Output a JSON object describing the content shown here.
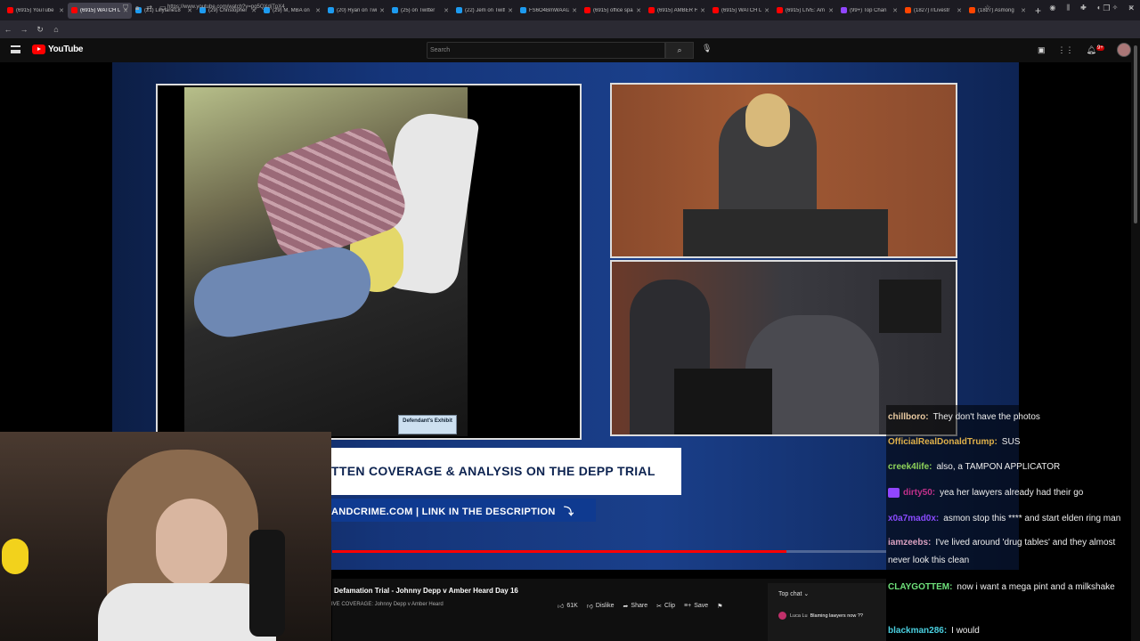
{
  "browser": {
    "tabs": [
      {
        "title": "(6915) YouTube",
        "color": "#f00"
      },
      {
        "title": "(6915) WATCH LIVE",
        "color": "#f00",
        "active": true
      },
      {
        "title": "(21) Lillylane18",
        "color": "#1d9bf0"
      },
      {
        "title": "(29) Christopher",
        "color": "#1d9bf0"
      },
      {
        "title": "(29) M, MBA on",
        "color": "#1d9bf0"
      },
      {
        "title": "(20) Ryan on Twitt",
        "color": "#1d9bf0"
      },
      {
        "title": "(25) on Twitter",
        "color": "#1d9bf0"
      },
      {
        "title": "(22) Jem on Twitt",
        "color": "#1d9bf0"
      },
      {
        "title": "FS6O4BmWAAU",
        "color": "#1d9bf0"
      },
      {
        "title": "(6915) office spa",
        "color": "#f00"
      },
      {
        "title": "(6915) AMBER H",
        "color": "#f00"
      },
      {
        "title": "(6915) WATCH L",
        "color": "#f00"
      },
      {
        "title": "(6915) LIVE: Am",
        "color": "#f00"
      },
      {
        "title": "(99+) Top Chan",
        "color": "#9146ff"
      },
      {
        "title": "(1827) r/Livestr",
        "color": "#ff4500"
      },
      {
        "title": "(1827) Asmong",
        "color": "#ff4500"
      }
    ],
    "url": "https://www.youtube.com/watch?v=pg5QXdjTpX4",
    "window_controls": [
      "–",
      "❐",
      "✕"
    ]
  },
  "youtube": {
    "logo_text": "YouTube",
    "search_placeholder": "Search",
    "notif_badge": "9+"
  },
  "video": {
    "banner_text": "TTEN COVERAGE & ANALYSIS ON THE DEPP TRIAL",
    "banner_link": "ANDCRIME.COM | LINK IN THE DESCRIPTION",
    "exhibit_label": "Defendant's Exhibit",
    "progress": 0.82,
    "title": "Defamation Trial - Johnny Depp v Amber Heard Day 16",
    "channel": "IVE COVERAGE: Johnny Depp v Amber Heard",
    "likes": "61K",
    "dislike_label": "Dislike",
    "share_label": "Share",
    "clip_label": "Clip",
    "save_label": "Save"
  },
  "top_chat": {
    "label": "Top chat",
    "message_user": "Luca Lu",
    "message_text": "Blaming lawyers now ??"
  },
  "stream_chat": [
    {
      "user": "chillboro:",
      "color": "#e8c9a0",
      "text": "They don't have the photos"
    },
    {
      "user": "OfficialRealDonaldTrump:",
      "color": "#e0b14a",
      "text": "SUS"
    },
    {
      "user": "creek4life:",
      "color": "#8fd45a",
      "text": "also, a TAMPON APPLICATOR"
    },
    {
      "user": "dirty50:",
      "color": "#c0308a",
      "text": "yea her lawyers already had their go"
    },
    {
      "user": "x0a7mad0x:",
      "color": "#8a4bff",
      "text": "asmon stop this **** and start elden ring man"
    },
    {
      "user": "iamzeebs:",
      "color": "#d9a0c0",
      "text": "I've lived around 'drug tables' and they almost never look this clean"
    },
    {
      "user": "CLAYGOTTEM:",
      "color": "#6ee07a",
      "text": "now i want a mega pint and a milkshake"
    },
    {
      "user": "blackman286:",
      "color": "#4ad0e0",
      "text": "I would"
    }
  ]
}
